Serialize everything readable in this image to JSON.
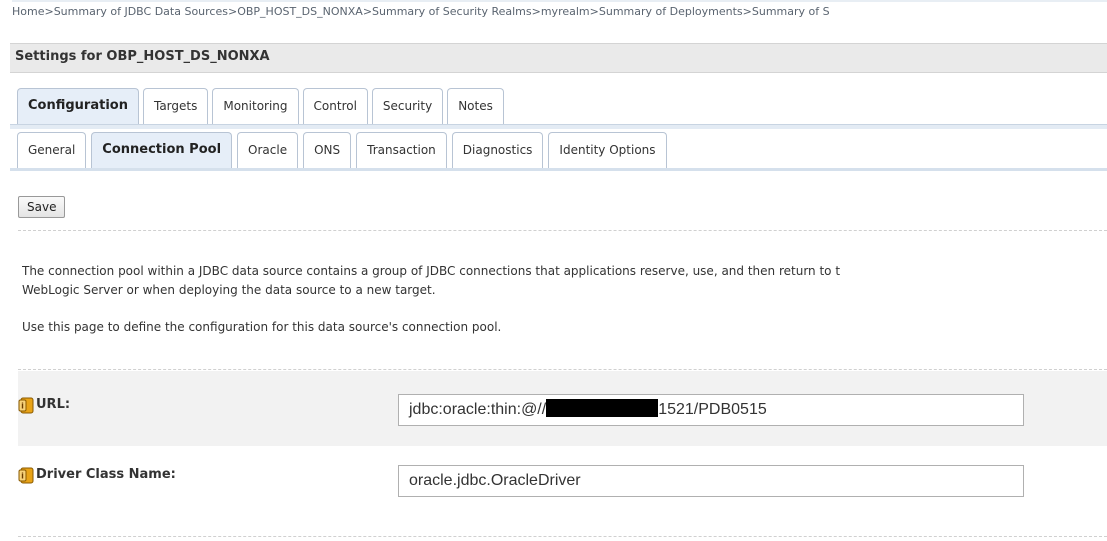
{
  "breadcrumb": {
    "items": [
      "Home",
      "Summary of JDBC Data Sources",
      "OBP_HOST_DS_NONXA",
      "Summary of Security Realms",
      "myrealm",
      "Summary of Deployments",
      "Summary of S"
    ],
    "separator": ">"
  },
  "settings": {
    "title": "Settings for OBP_HOST_DS_NONXA"
  },
  "tabs": [
    {
      "label": "Configuration",
      "active": true
    },
    {
      "label": "Targets",
      "active": false
    },
    {
      "label": "Monitoring",
      "active": false
    },
    {
      "label": "Control",
      "active": false
    },
    {
      "label": "Security",
      "active": false
    },
    {
      "label": "Notes",
      "active": false
    }
  ],
  "subtabs": [
    {
      "label": "General",
      "active": false
    },
    {
      "label": "Connection Pool",
      "active": true
    },
    {
      "label": "Oracle",
      "active": false
    },
    {
      "label": "ONS",
      "active": false
    },
    {
      "label": "Transaction",
      "active": false
    },
    {
      "label": "Diagnostics",
      "active": false
    },
    {
      "label": "Identity Options",
      "active": false
    }
  ],
  "toolbar": {
    "save_label": "Save"
  },
  "description": {
    "line1": "The connection pool within a JDBC data source contains a group of JDBC connections that applications reserve, use, and then return to t",
    "line2": "WebLogic Server or when deploying the data source to a new target.",
    "line3": "Use this page to define the configuration for this data source's connection pool."
  },
  "fields": {
    "url": {
      "label": "URL:",
      "value_prefix": "jdbc:oracle:thin:@//",
      "value_suffix": "1521/PDB0515"
    },
    "driver": {
      "label": "Driver Class Name:",
      "value": "oracle.jdbc.OracleDriver"
    }
  },
  "icons": {
    "help": "help-icon"
  },
  "colors": {
    "active_tab_bg": "#e6eef8",
    "tab_border": "#b8c4d4",
    "row_bg": "#f2f2f2"
  }
}
